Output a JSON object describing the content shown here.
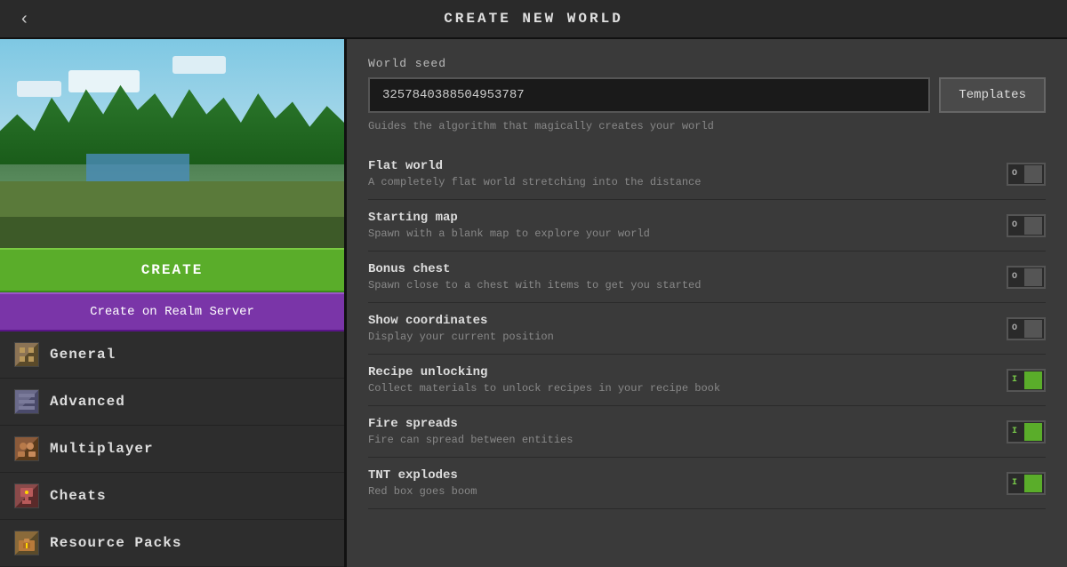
{
  "header": {
    "title": "CREATE NEW WORLD",
    "back_label": "‹"
  },
  "sidebar": {
    "create_label": "CREATE",
    "realm_label": "Create on Realm Server",
    "nav_items": [
      {
        "id": "general",
        "label": "General",
        "icon": "general"
      },
      {
        "id": "advanced",
        "label": "Advanced",
        "icon": "advanced"
      },
      {
        "id": "multiplayer",
        "label": "Multiplayer",
        "icon": "multiplayer"
      },
      {
        "id": "cheats",
        "label": "Cheats",
        "icon": "cheats"
      },
      {
        "id": "resource-packs",
        "label": "Resource Packs",
        "icon": "resource"
      }
    ]
  },
  "content": {
    "world_seed": {
      "label": "World seed",
      "value": "3257840388504953787",
      "hint": "Guides the algorithm that magically creates your world",
      "templates_label": "Templates"
    },
    "settings": [
      {
        "name": "Flat world",
        "desc": "A completely flat world stretching into the distance",
        "state": "off"
      },
      {
        "name": "Starting map",
        "desc": "Spawn with a blank map to explore your world",
        "state": "off"
      },
      {
        "name": "Bonus chest",
        "desc": "Spawn close to a chest with items to get you started",
        "state": "off"
      },
      {
        "name": "Show coordinates",
        "desc": "Display your current position",
        "state": "off"
      },
      {
        "name": "Recipe unlocking",
        "desc": "Collect materials to unlock recipes in your recipe book",
        "state": "on"
      },
      {
        "name": "Fire spreads",
        "desc": "Fire can spread between entities",
        "state": "on"
      },
      {
        "name": "TNT explodes",
        "desc": "Red box goes boom",
        "state": "on"
      }
    ]
  }
}
